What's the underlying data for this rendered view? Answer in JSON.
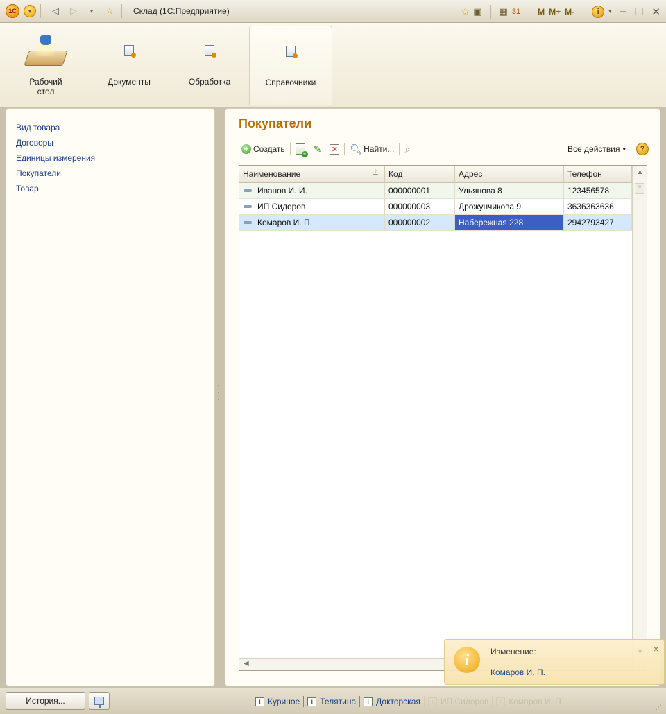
{
  "window": {
    "title": "Склад  (1С:Предприятие)",
    "logo_text": "1C",
    "memory_buttons": [
      "M",
      "M+",
      "M-"
    ]
  },
  "sections": [
    {
      "label": "Рабочий стол",
      "icon": "desktop-icon"
    },
    {
      "label": "Документы",
      "icon": "documents-icon"
    },
    {
      "label": "Обработка",
      "icon": "processing-icon"
    },
    {
      "label": "Справочники",
      "icon": "catalogs-icon",
      "active": true
    }
  ],
  "nav": {
    "items": [
      "Вид товара",
      "Договоры",
      "Единицы измерения",
      "Покупатели",
      "Товар"
    ]
  },
  "main": {
    "title": "Покупатели",
    "toolbar": {
      "create_label": "Создать",
      "find_label": "Найти...",
      "all_actions_label": "Все действия",
      "help_label": "?"
    },
    "table": {
      "columns": [
        "Наименование",
        "Код",
        "Адрес",
        "Телефон"
      ],
      "rows": [
        {
          "name": "Иванов И. И.",
          "code": "000000001",
          "address": "Ульянова 8",
          "phone": "123456578"
        },
        {
          "name": "ИП Сидоров",
          "code": "000000003",
          "address": "Дрожунчикова 9",
          "phone": "3636363636"
        },
        {
          "name": "Комаров И. П.",
          "code": "000000002",
          "address": "Набережная 228",
          "phone": "2942793427",
          "selected": true
        }
      ]
    }
  },
  "notification": {
    "title": "Изменение:",
    "link": "Комаров И. П."
  },
  "statusbar": {
    "history_label": "История...",
    "history_items": [
      {
        "label": "Куриное",
        "faded": false
      },
      {
        "label": "Телятина",
        "faded": false
      },
      {
        "label": "Докторская",
        "faded": false
      },
      {
        "label": "ИП Сидоров",
        "faded": true
      },
      {
        "label": "Комаров И. П.",
        "faded": true
      }
    ]
  },
  "colors": {
    "accent_title": "#b56f00",
    "link": "#1c3f8c",
    "selection": "#3b5fc4",
    "selected_row": "#d6e8fb"
  }
}
